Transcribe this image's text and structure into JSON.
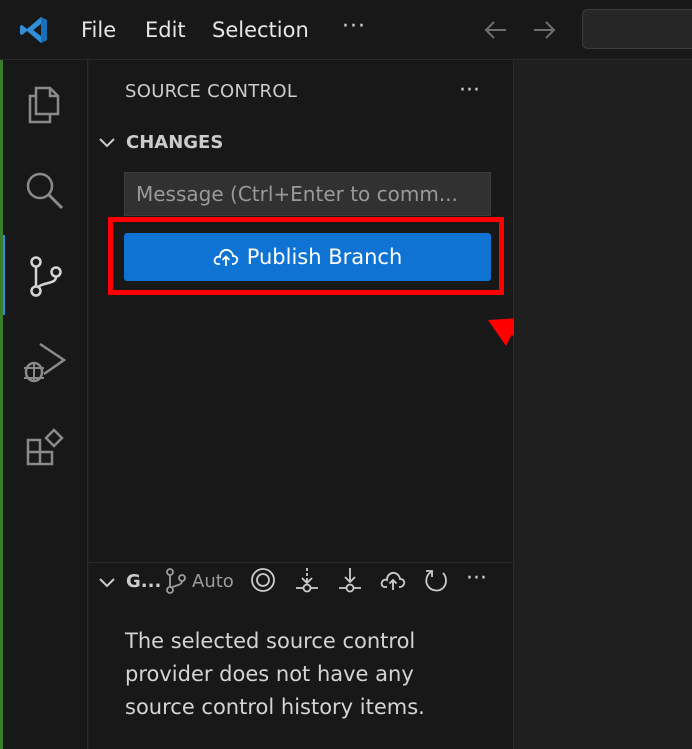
{
  "titlebar": {
    "menu": [
      "File",
      "Edit",
      "Selection"
    ],
    "more": "···"
  },
  "activity_bar": {
    "items": [
      "explorer-icon",
      "search-icon",
      "source-control-icon",
      "run-debug-icon",
      "extensions-icon"
    ],
    "active": "source-control-icon"
  },
  "sidebar": {
    "title": "SOURCE CONTROL",
    "more": "···",
    "changes_label": "CHANGES",
    "commit_placeholder": "Message (Ctrl+Enter to comm...",
    "publish_label": "Publish Branch"
  },
  "graph": {
    "title": "G...",
    "auto_label": "Auto",
    "more": "···",
    "empty_message": "The selected source control provider does not have any source control history items."
  },
  "colors": {
    "accent": "#0e73d2",
    "highlight": "#ff0000",
    "background": "#181818"
  }
}
